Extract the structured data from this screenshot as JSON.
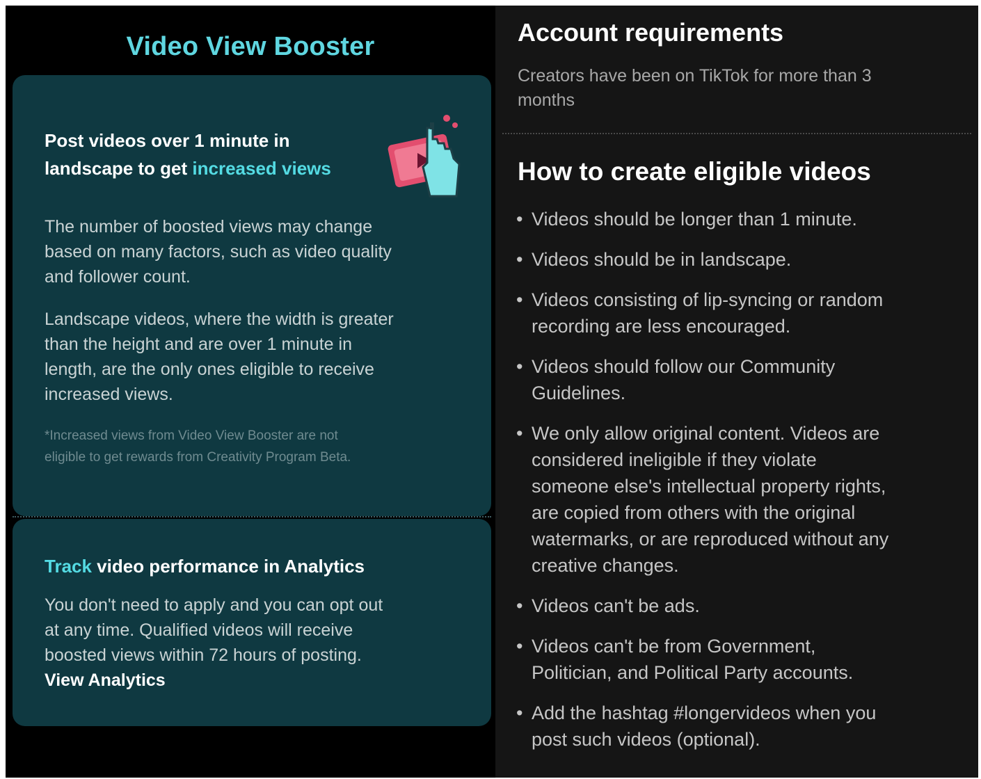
{
  "left": {
    "title": "Video View Booster",
    "card1": {
      "heading_line1": "Post videos over 1 minute in",
      "heading_line2_prefix": "landscape to get ",
      "heading_line2_accent": "increased views",
      "paragraph1_lines": [
        "The number of boosted views may change",
        "based on many factors, such as video quality",
        "and follower count."
      ],
      "paragraph2_lines": [
        "Landscape videos, where the width is greater",
        "than the height and are over 1 minute in",
        "length, are the only ones eligible to receive",
        "increased views."
      ],
      "note_lines": [
        "*Increased views from Video View Booster are not",
        "eligible to get rewards from Creativity Program Beta."
      ]
    },
    "card2": {
      "heading_accent": "Track",
      "heading_rest": " video performance in Analytics",
      "paragraph_lines": [
        "You don't need to apply and you can opt out",
        "at any time. Qualified videos will receive",
        "boosted views within 72 hours of posting."
      ],
      "link_label": "View Analytics"
    }
  },
  "right": {
    "requirements": {
      "title": "Account requirements",
      "text_lines": [
        "Creators have been on TikTok for more than 3",
        "months"
      ]
    },
    "eligible": {
      "title": "How to create eligible videos",
      "bullets": [
        {
          "lines": [
            "Videos should be longer than 1 minute."
          ]
        },
        {
          "lines": [
            "Videos should be in landscape."
          ]
        },
        {
          "lines": [
            "Videos consisting of lip-syncing or random",
            "recording are less encouraged."
          ]
        },
        {
          "lines": [
            "Videos should follow our Community",
            "Guidelines."
          ]
        },
        {
          "lines": [
            "We only allow original content. Videos are",
            "considered ineligible if they violate",
            "someone else's intellectual property rights,",
            "are copied from others with the original",
            "watermarks, or are reproduced without any",
            "creative changes."
          ]
        },
        {
          "lines": [
            "Videos can't be ads."
          ]
        },
        {
          "lines": [
            "Videos can't be from Government,",
            "Politician, and Political Party accounts."
          ]
        },
        {
          "lines": [
            "Add the hashtag #longervideos when you",
            "post such videos (optional)."
          ]
        }
      ]
    }
  },
  "colors": {
    "accent": "#54dbe3",
    "card_bg": "#0f3941",
    "right_bg": "#151515"
  },
  "icons": {
    "illustration": "hand-pointing-at-video-icon"
  }
}
